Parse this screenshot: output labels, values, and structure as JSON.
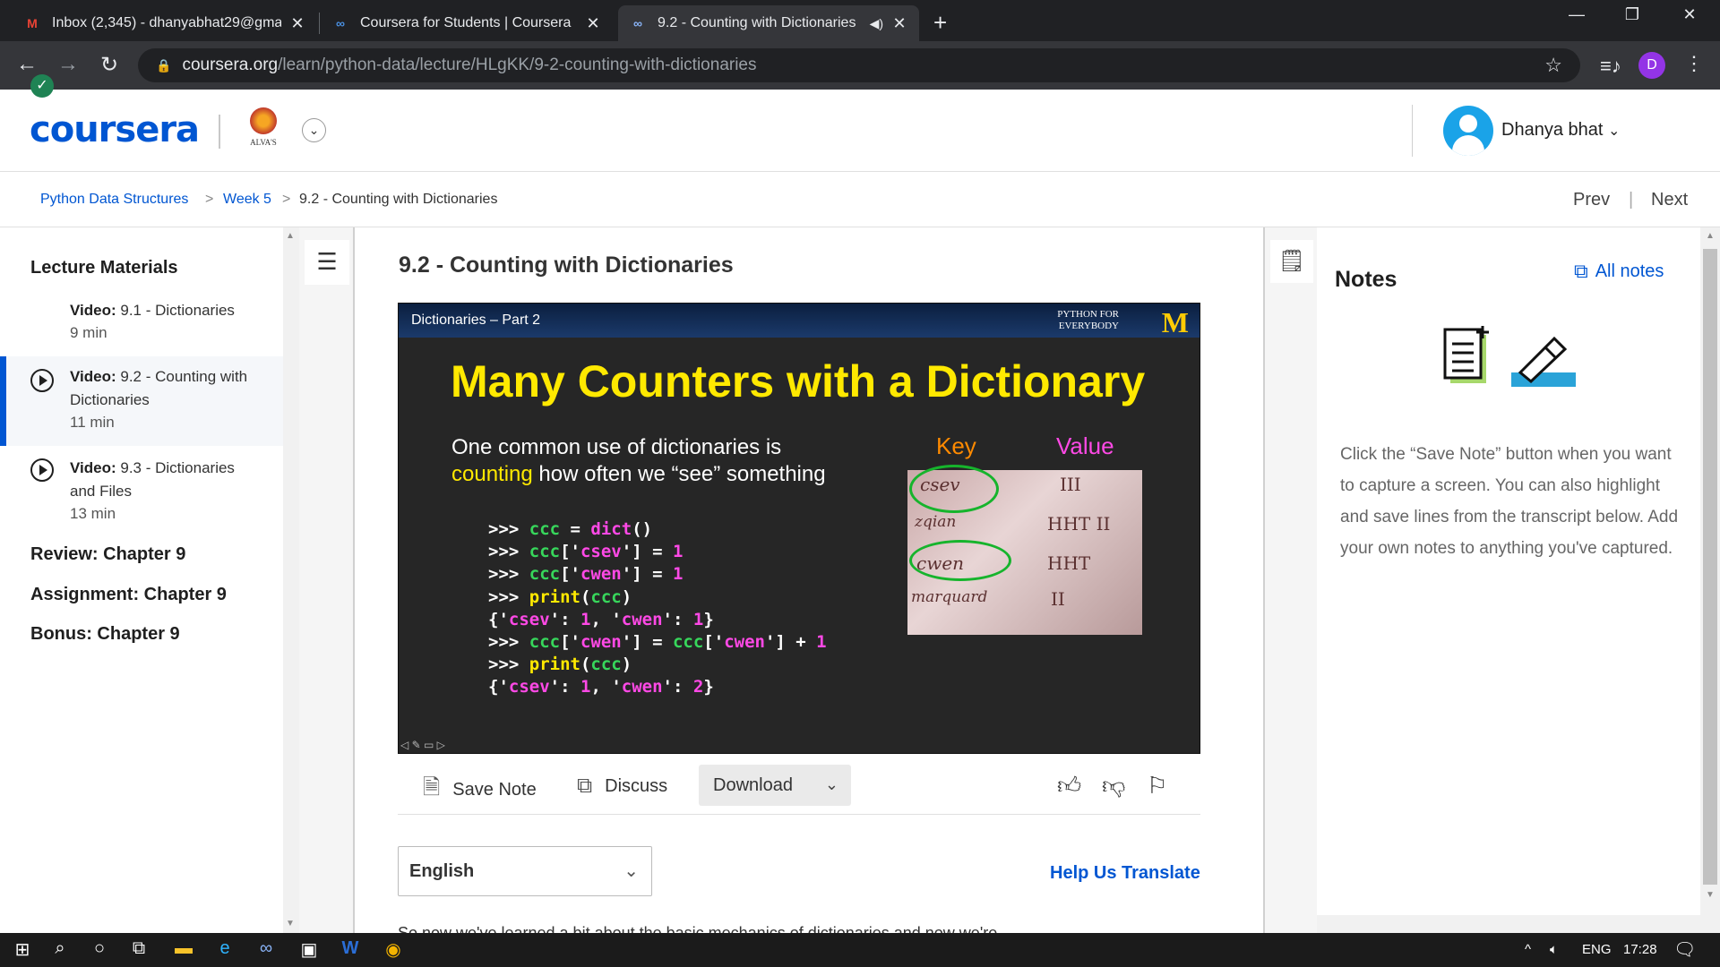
{
  "browser": {
    "tabs": [
      {
        "title": "Inbox (2,345) - dhanyabhat29@gma",
        "icon": "gmail-icon",
        "active": false
      },
      {
        "title": "Coursera for Students | Coursera",
        "icon": "coursera-icon",
        "active": false
      },
      {
        "title": "9.2 - Counting with Dictionaries",
        "icon": "coursera-icon",
        "active": true
      }
    ],
    "url_domain": "coursera.org",
    "url_path": "/learn/python-data/lecture/HLgKK/9-2-counting-with-dictionaries",
    "profile_initial": "D"
  },
  "header": {
    "logo": "coursera",
    "institution_text": "ALVA'S",
    "user_name": "Dhanya bhat"
  },
  "breadcrumb": {
    "course": "Python Data Structures",
    "week": "Week 5",
    "current": "9.2 - Counting with Dictionaries",
    "prev": "Prev",
    "next": "Next",
    "sep": ">",
    "divider": "|"
  },
  "sidebar": {
    "title": "Lecture Materials",
    "lessons": [
      {
        "type": "Video:",
        "name": "9.1 - Dictionaries",
        "duration": "9 min",
        "status": "done"
      },
      {
        "type": "Video:",
        "name": "9.2 - Counting with Dictionaries",
        "duration": "11 min",
        "status": "active"
      },
      {
        "type": "Video:",
        "name": "9.3 - Dictionaries and Files",
        "duration": "13 min",
        "status": "todo"
      }
    ],
    "links": [
      "Review: Chapter 9",
      "Assignment: Chapter 9",
      "Bonus: Chapter 9"
    ]
  },
  "lecture": {
    "title": "9.2 - Counting with Dictionaries"
  },
  "video": {
    "band_title": "Dictionaries – Part 2",
    "brand_line1": "PYTHON FOR",
    "brand_line2": "EVERYBODY",
    "brand_logo": "M",
    "heading": "Many Counters with a Dictionary",
    "para_line1": "One common use of dictionaries is",
    "para_highlight": "counting",
    "para_line2_rest": " how often we “see” something",
    "key_label": "Key",
    "value_label": "Value",
    "handwriting": {
      "k1": "csev",
      "k2": "zqian",
      "k3": "cwen",
      "k4": "marquard",
      "v1": "III",
      "v2": "HHT II",
      "v3": "HHT",
      "v4": "II"
    },
    "code": {
      "l1_prompt": ">>> ",
      "l1_var": "ccc",
      "l1_eq": " = ",
      "l1_fn": "dict",
      "l1_paren": "()",
      "l2_prompt": ">>> ",
      "l2_var": "ccc",
      "l2_b1": "['",
      "l2_key": "csev",
      "l2_b2": "']",
      "l2_eq": " = ",
      "l2_val": "1",
      "l3_prompt": ">>> ",
      "l3_var": "ccc",
      "l3_b1": "['",
      "l3_key": "cwen",
      "l3_b2": "']",
      "l3_eq": " = ",
      "l3_val": "1",
      "l4_prompt": ">>> ",
      "l4_fn": "print",
      "l4_p1": "(",
      "l4_var": "ccc",
      "l4_p2": ")",
      "l5_o": "{'",
      "l5_k1": "csev",
      "l5_c1": "': ",
      "l5_v1": "1",
      "l5_s": ", '",
      "l5_k2": "cwen",
      "l5_c2": "': ",
      "l5_v2": "1",
      "l5_e": "}",
      "l6_prompt": ">>> ",
      "l6_var": "ccc",
      "l6_b1": "['",
      "l6_key": "cwen",
      "l6_b2": "']",
      "l6_eq": " = ",
      "l6_var2": "ccc",
      "l6_b3": "['",
      "l6_key2": "cwen",
      "l6_b4": "']",
      "l6_plus": " + ",
      "l6_val": "1",
      "l7_prompt": ">>> ",
      "l7_fn": "print",
      "l7_p1": "(",
      "l7_var": "ccc",
      "l7_p2": ")",
      "l8_o": "{'",
      "l8_k1": "csev",
      "l8_c1": "': ",
      "l8_v1": "1",
      "l8_s": ", '",
      "l8_k2": "cwen",
      "l8_c2": "': ",
      "l8_v2": "2",
      "l8_e": "}"
    }
  },
  "actions": {
    "save_note": "Save Note",
    "discuss": "Discuss",
    "download": "Download"
  },
  "transcript": {
    "language": "English",
    "help_translate": "Help Us Translate",
    "first_line": "So now we've learned a bit about the basic mechanics of dictionaries and now we're"
  },
  "notes": {
    "title": "Notes",
    "all_notes": "All notes",
    "hint": "Click the “Save Note” button when you want to capture a screen. You can also highlight and save lines from the transcript below. Add your own notes to anything you've captured."
  },
  "taskbar": {
    "language": "ENG",
    "time": "17:28"
  },
  "colors": {
    "brand_blue": "#0056d2",
    "slide_yellow": "#ffe900",
    "code_green": "#37d65b",
    "code_magenta": "#ff49e6",
    "done_green": "#1f8354"
  }
}
